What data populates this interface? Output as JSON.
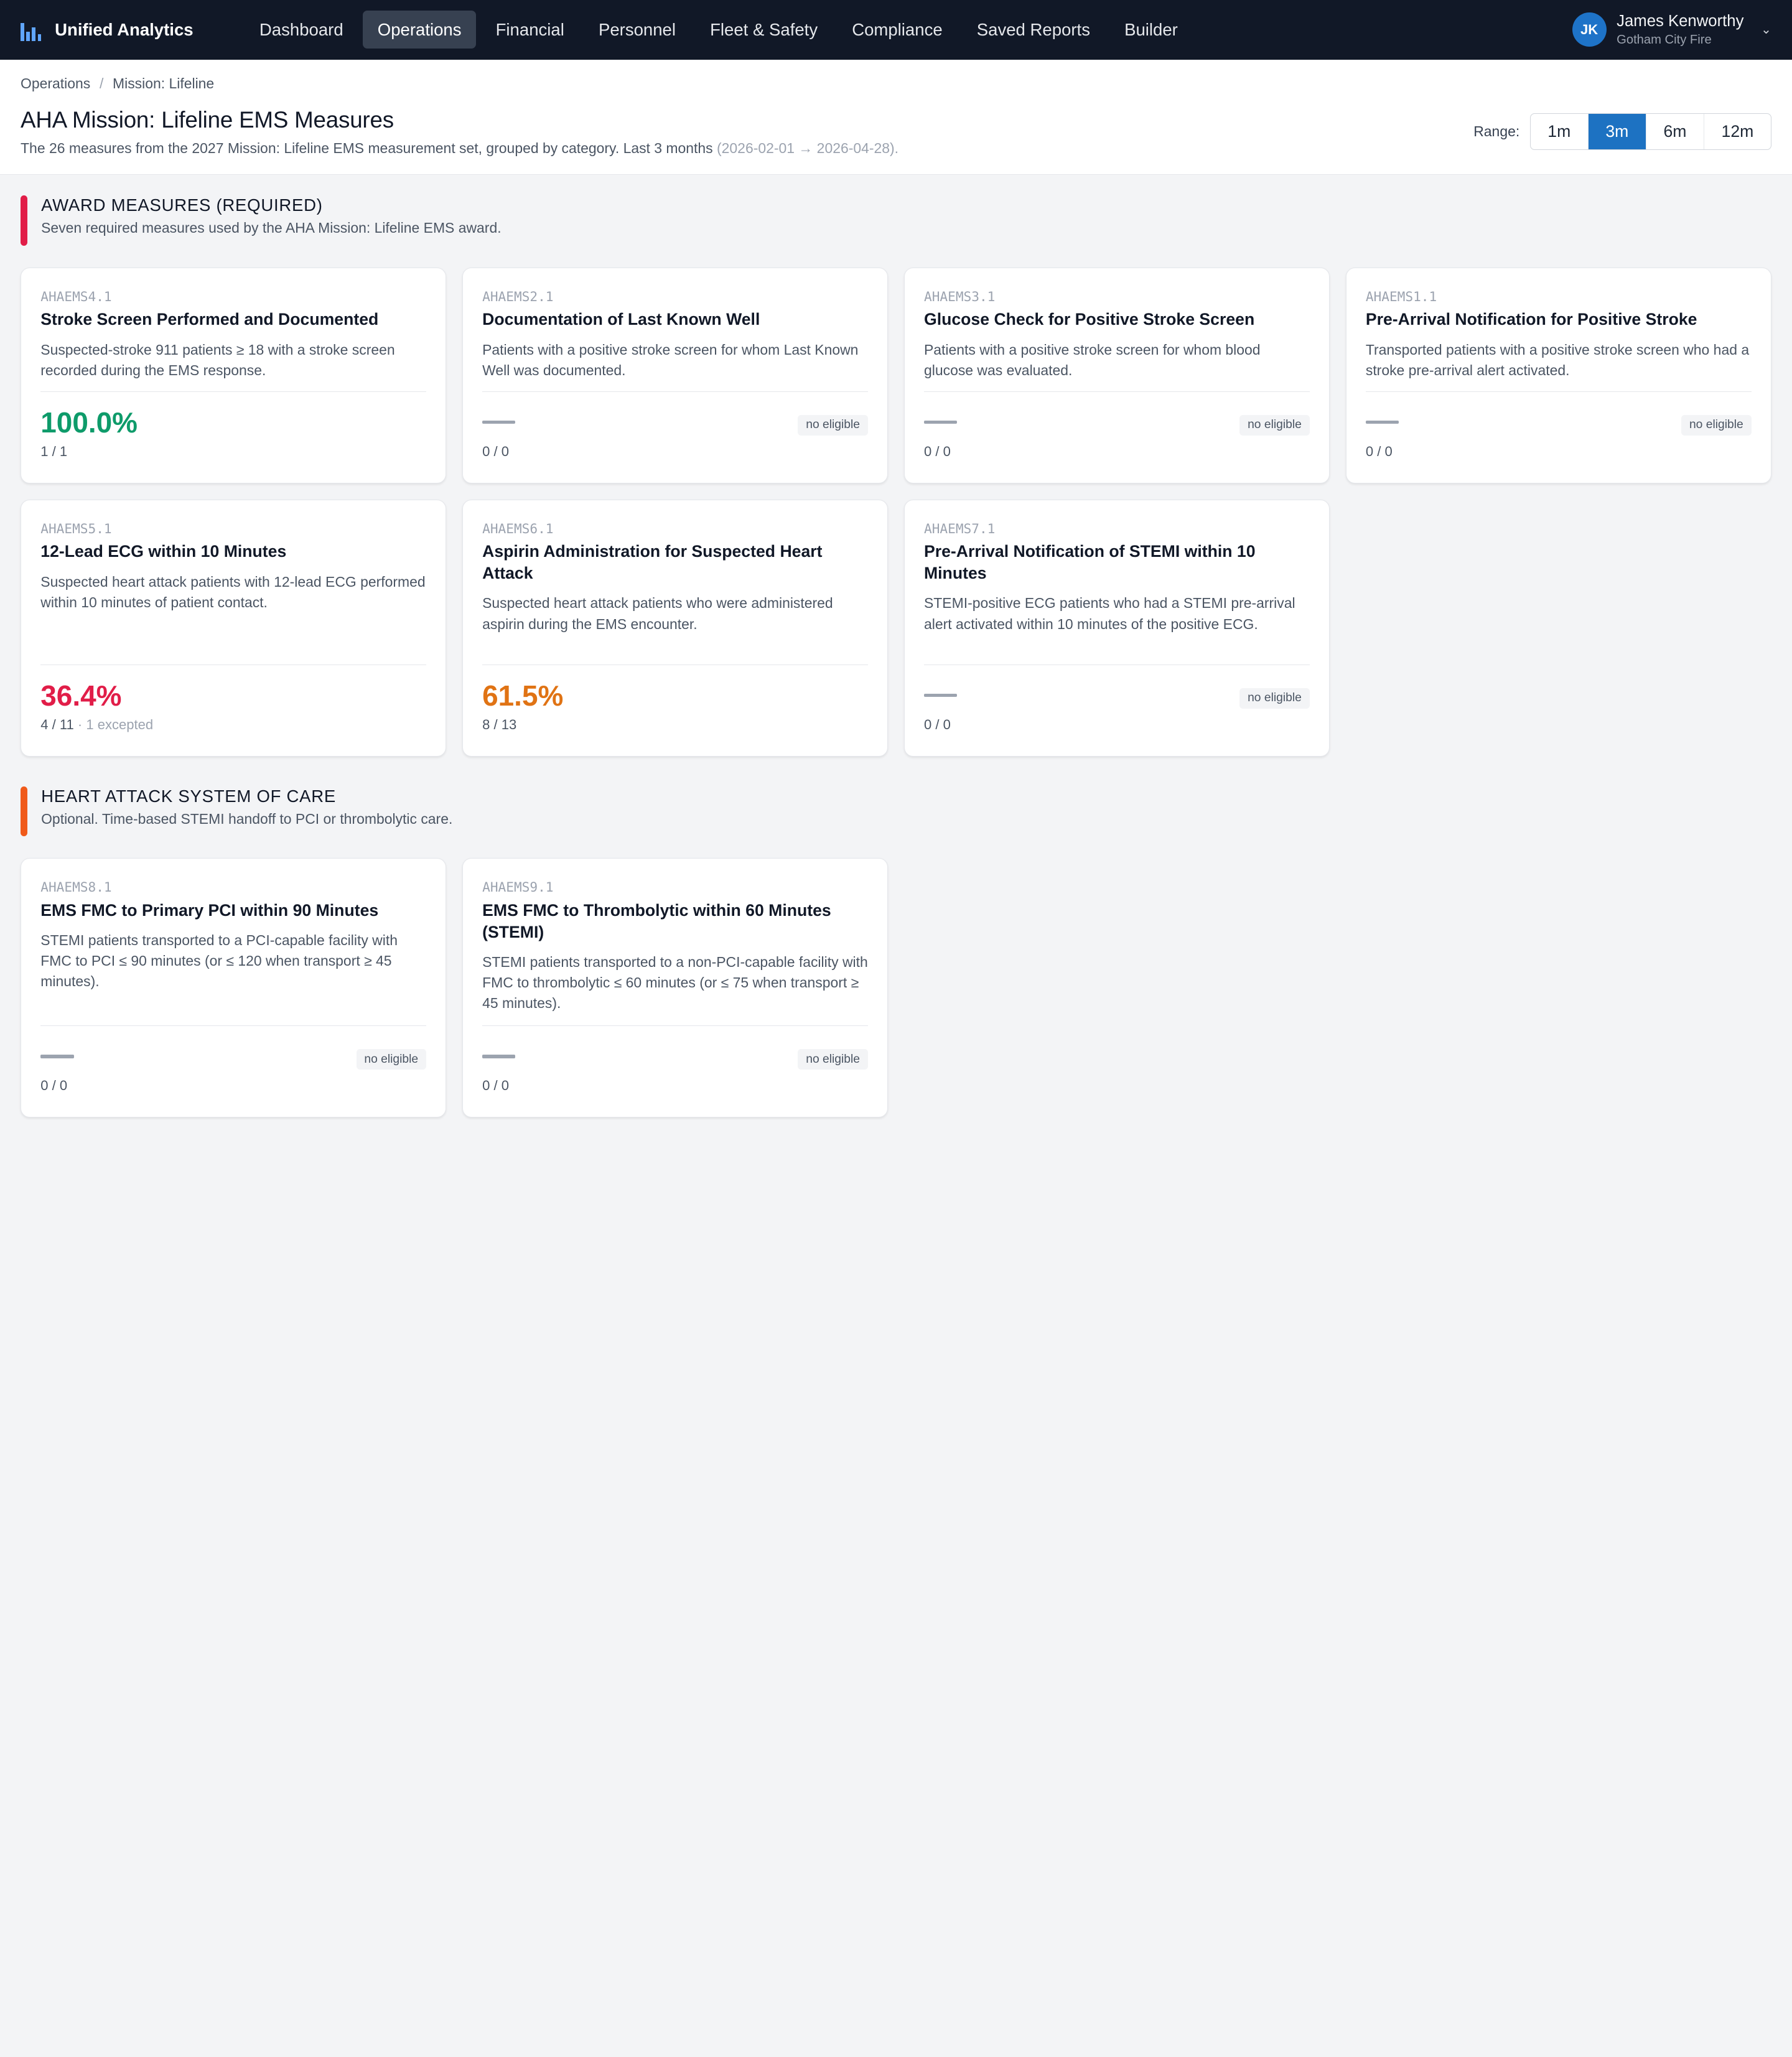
{
  "app": {
    "name": "Unified Analytics",
    "nav": [
      "Dashboard",
      "Operations",
      "Financial",
      "Personnel",
      "Fleet & Safety",
      "Compliance",
      "Saved Reports",
      "Builder"
    ],
    "active_nav": "Operations",
    "user": {
      "initials": "JK",
      "name": "James Kenworthy",
      "org": "Gotham City Fire"
    }
  },
  "breadcrumb": [
    "Operations",
    "Mission: Lifeline"
  ],
  "page": {
    "title": "AHA Mission: Lifeline EMS Measures",
    "subtitle": "The 26 measures from the 2027 Mission: Lifeline EMS measurement set, grouped by category. Last 3 months",
    "dates": "(2026-02-01 → 2026-04-28)."
  },
  "range": {
    "label": "Range:",
    "options": [
      "1m",
      "3m",
      "6m",
      "12m"
    ],
    "selected": "3m"
  },
  "colors": {
    "good": "#0e9b6a",
    "bad": "#e11d48",
    "warn": "#e07314",
    "award_accent": "#e11d48",
    "heart_accent": "#f05a1a"
  },
  "sections": [
    {
      "title": "AWARD MEASURES (REQUIRED)",
      "subtitle": "Seven required measures used by the AHA Mission: Lifeline EMS award.",
      "accent": "#e11d48",
      "cards": [
        {
          "code": "AHAEMS4.1",
          "title": "Stroke Screen Performed and Documented",
          "desc": "Suspected-stroke 911 patients ≥ 18 with a stroke screen recorded during the EMS response.",
          "value": "100.0%",
          "status": "good",
          "counts": "1 / 1"
        },
        {
          "code": "AHAEMS2.1",
          "title": "Documentation of Last Known Well",
          "desc": "Patients with a positive stroke screen for whom Last Known Well was documented.",
          "value": null,
          "badge": "no eligible",
          "counts": "0 / 0"
        },
        {
          "code": "AHAEMS3.1",
          "title": "Glucose Check for Positive Stroke Screen",
          "desc": "Patients with a positive stroke screen for whom blood glucose was evaluated.",
          "value": null,
          "badge": "no eligible",
          "counts": "0 / 0"
        },
        {
          "code": "AHAEMS1.1",
          "title": "Pre-Arrival Notification for Positive Stroke",
          "desc": "Transported patients with a positive stroke screen who had a stroke pre-arrival alert activated.",
          "value": null,
          "badge": "no eligible",
          "counts": "0 / 0"
        },
        {
          "code": "AHAEMS5.1",
          "title": "12-Lead ECG within 10 Minutes",
          "desc": "Suspected heart attack patients with 12-lead ECG performed within 10 minutes of patient contact.",
          "value": "36.4%",
          "status": "bad",
          "counts": "4 / 11",
          "excepted": "1 excepted"
        },
        {
          "code": "AHAEMS6.1",
          "title": "Aspirin Administration for Suspected Heart Attack",
          "desc": "Suspected heart attack patients who were administered aspirin during the EMS encounter.",
          "value": "61.5%",
          "status": "warn",
          "counts": "8 / 13"
        },
        {
          "code": "AHAEMS7.1",
          "title": "Pre-Arrival Notification of STEMI within 10 Minutes",
          "desc": "STEMI-positive ECG patients who had a STEMI pre-arrival alert activated within 10 minutes of the positive ECG.",
          "value": null,
          "badge": "no eligible",
          "counts": "0 / 0"
        }
      ]
    },
    {
      "title": "HEART ATTACK SYSTEM OF CARE",
      "subtitle": "Optional. Time-based STEMI handoff to PCI or thrombolytic care.",
      "accent": "#f05a1a",
      "cards": [
        {
          "code": "AHAEMS8.1",
          "title": "EMS FMC to Primary PCI within 90 Minutes",
          "desc": "STEMI patients transported to a PCI-capable facility with FMC to PCI ≤ 90 minutes (or ≤ 120 when transport ≥ 45 minutes).",
          "value": null,
          "badge": "no eligible",
          "counts": "0 / 0"
        },
        {
          "code": "AHAEMS9.1",
          "title": "EMS FMC to Thrombolytic within 60 Minutes (STEMI)",
          "desc": "STEMI patients transported to a non-PCI-capable facility with FMC to thrombolytic ≤ 60 minutes (or ≤ 75 when transport ≥ 45 minutes).",
          "value": null,
          "badge": "no eligible",
          "counts": "0 / 0"
        }
      ]
    }
  ]
}
